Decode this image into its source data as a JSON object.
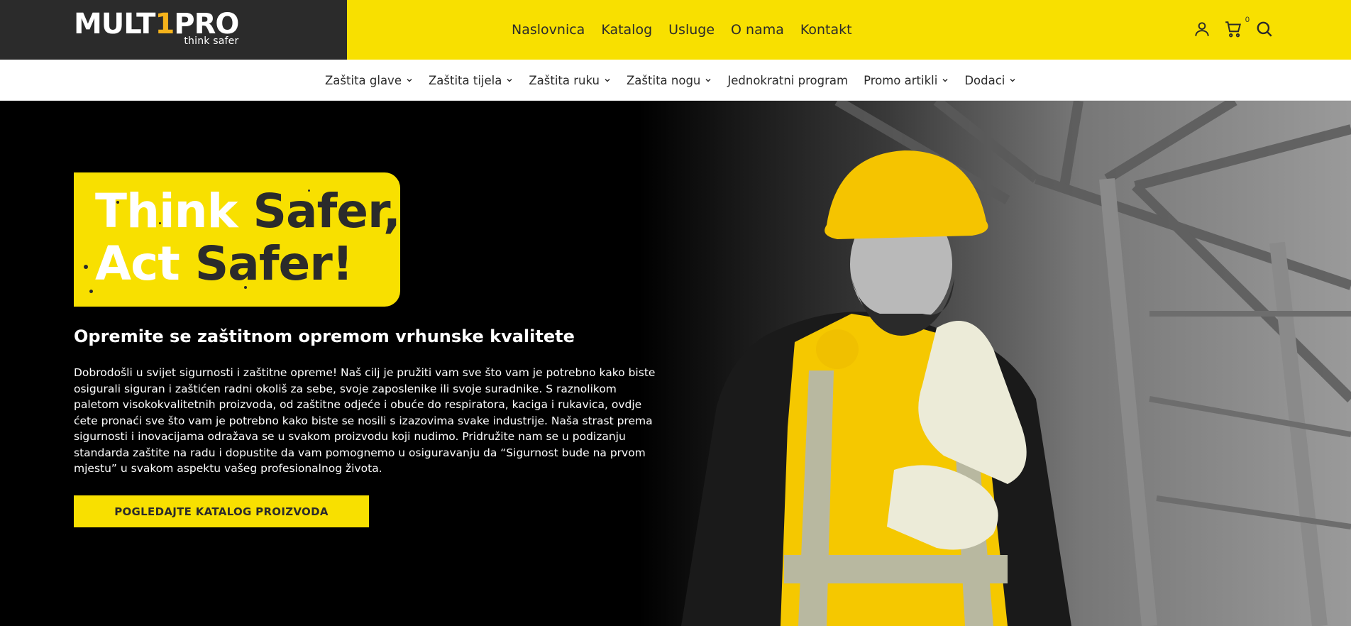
{
  "brand": {
    "logo_main_1": "MULT",
    "logo_main_accent": "1",
    "logo_main_2": "PRO",
    "logo_tagline": "think safer",
    "colors": {
      "yellow": "#f8e000",
      "dark": "#2b2b2b",
      "accent": "#f5b31b"
    }
  },
  "main_nav": {
    "items": [
      {
        "label": "Naslovnica"
      },
      {
        "label": "Katalog"
      },
      {
        "label": "Usluge"
      },
      {
        "label": "O nama"
      },
      {
        "label": "Kontakt"
      }
    ]
  },
  "header_icons": {
    "account": "user-icon",
    "cart": "cart-icon",
    "cart_count": "0",
    "search": "search-icon"
  },
  "categories": {
    "items": [
      {
        "label": "Zaštita glave",
        "has_dropdown": true
      },
      {
        "label": "Zaštita tijela",
        "has_dropdown": true
      },
      {
        "label": "Zaštita ruku",
        "has_dropdown": true
      },
      {
        "label": "Zaštita nogu",
        "has_dropdown": true
      },
      {
        "label": "Jednokratni program",
        "has_dropdown": false
      },
      {
        "label": "Promo artikli",
        "has_dropdown": true
      },
      {
        "label": "Dodaci",
        "has_dropdown": true
      }
    ]
  },
  "hero": {
    "badge_word_1": "Think",
    "badge_word_2": "Safer,",
    "badge_word_3": "Act",
    "badge_word_4": "Safer!",
    "title": "Opremite se zaštitnom opremom vrhunske kvalitete",
    "body": "Dobrodošli u svijet sigurnosti i zaštitne opreme! Naš cilj je pružiti vam sve što vam je potrebno kako biste osigurali siguran i zaštićen radni okoliš za sebe, svoje zaposlenike ili svoje suradnike. S raznolikom paletom visokokvalitetnih proizvoda, od zaštitne odjeće i obuće do respiratora, kaciga i rukavica, ovdje ćete pronaći sve što vam je potrebno kako biste se nosili s izazovima svake industrije. Naša strast prema sigurnosti i inovacijama odražava se u svakom proizvodu koji nudimo. Pridružite nam se u podizanju standarda zaštite na radu i dopustite da vam pomognemo u osiguravanju da “Sigurnost bude na prvom mjestu” u svakom aspektu vašeg profesionalnog života.",
    "cta_label": "POGLEDAJTE KATALOG PROIZVODA"
  }
}
